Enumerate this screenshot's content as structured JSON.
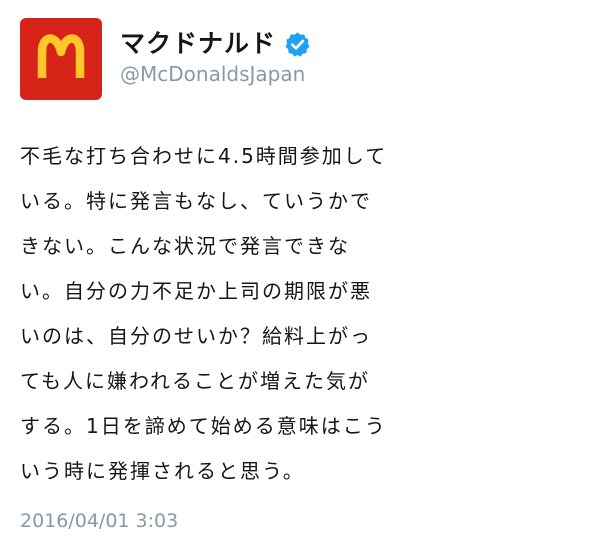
{
  "account": {
    "display_name": "マクドナルド",
    "handle": "@McDonaldsJapan",
    "verified": true,
    "avatar_icon": "mcdonalds-golden-arches-logo",
    "verified_icon": "verified-badge-icon",
    "colors": {
      "avatar_bg": "#d62418",
      "logo_yellow": "#ffc72c",
      "verified_blue": "#1da1f2"
    }
  },
  "tweet": {
    "lines": [
      "不毛な打ち合わせに4.5時間参加して",
      "いる。特に発言もなし、ていうかで",
      "きない。こんな状況で発言できな",
      "い。自分の力不足か上司の期限が悪",
      "いのは、自分のせいか？給料上がっ",
      "ても人に嫌われることが増えた気が",
      "する。1日を諦めて始める意味はこう",
      "いう時に発揮されると思う。"
    ],
    "timestamp": "2016/04/01 3:03"
  }
}
